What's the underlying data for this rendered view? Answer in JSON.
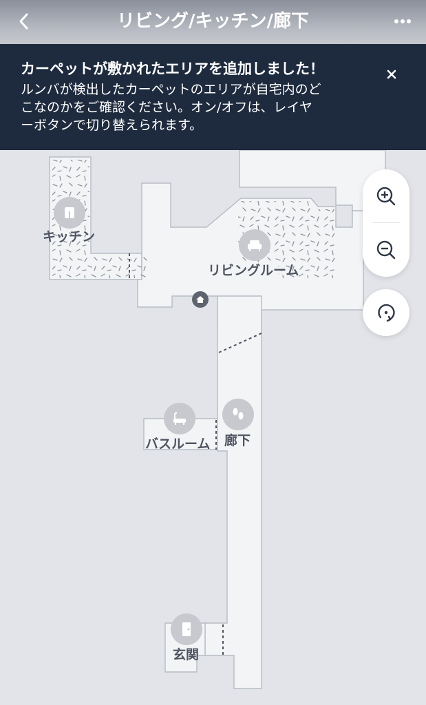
{
  "header": {
    "title": "リビング/キッチン/廊下",
    "back_icon": "chevron-left-icon",
    "more_icon": "more-icon"
  },
  "banner": {
    "title": "カーペットが敷かれたエリアを追加しました！",
    "body_lines": [
      "ルンバが検出したカーペットのエリアが自宅内のど",
      "こなのかをご確認ください。オン/オフは、レイヤ",
      "ーボタンで切り替えられます。"
    ],
    "close_icon": "close-icon"
  },
  "map": {
    "rooms": [
      {
        "label": "キッチン",
        "icon": "kitchen-icon"
      },
      {
        "label": "リビングルーム",
        "icon": "sofa-icon"
      },
      {
        "label": "バスルーム",
        "icon": "bathtub-icon"
      },
      {
        "label": "廊下",
        "icon": "footprints-icon"
      },
      {
        "label": "玄関",
        "icon": "door-icon"
      }
    ],
    "dock_icon": "home-dock-icon"
  },
  "controls": {
    "zoom_in_icon": "zoom-in-icon",
    "zoom_out_icon": "zoom-out-icon",
    "rotate_icon": "rotate-icon"
  },
  "colors": {
    "header_text": "#ffffff",
    "banner_bg": "#1e2b3e",
    "map_bg": "#e2e4ea",
    "floor": "#f3f4f6",
    "carpet_hatch": "#8f949c"
  }
}
